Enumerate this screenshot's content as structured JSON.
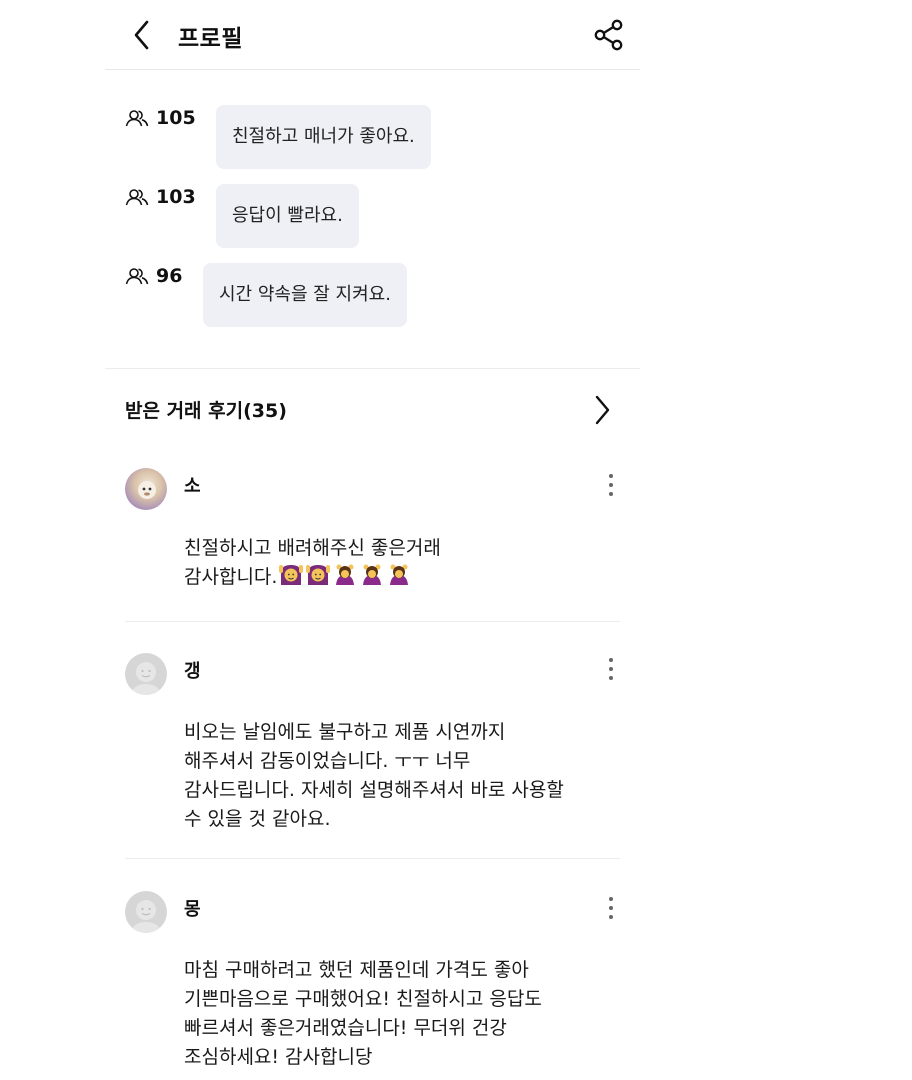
{
  "header": {
    "title": "프로필"
  },
  "manner": [
    {
      "count": "105",
      "text": "친절하고 매너가 좋아요."
    },
    {
      "count": "103",
      "text": "응답이 빨라요."
    },
    {
      "count": "96",
      "text": "시간 약속을 잘 지켜요."
    }
  ],
  "reviews_section": {
    "title": "받은 거래 후기(35)"
  },
  "reviews": [
    {
      "name": "소",
      "text": "친절하시고 배려해주신  좋은거래\n감사합니다."
    },
    {
      "name": "갱",
      "text": "비오는 날임에도 불구하고 제품 시연까지\n해주셔서 감동이었습니다. ㅜㅜ 너무\n감사드립니다. 자세히 설명해주셔서 바로 사용할\n수 있을 것 같아요."
    },
    {
      "name": "몽",
      "text": "마침 구매하려고 했던 제품인데 가격도 좋아\n기쁜마음으로 구매했어요! 친절하시고 응답도\n빠르셔서 좋은거래였습니다!  무더위 건강\n조심하세요! 감사합니당"
    }
  ],
  "icons": {
    "back": "chevron-left-icon",
    "share": "share-icon",
    "people": "people-icon",
    "more": "more-vertical-icon",
    "next": "chevron-right-icon"
  }
}
